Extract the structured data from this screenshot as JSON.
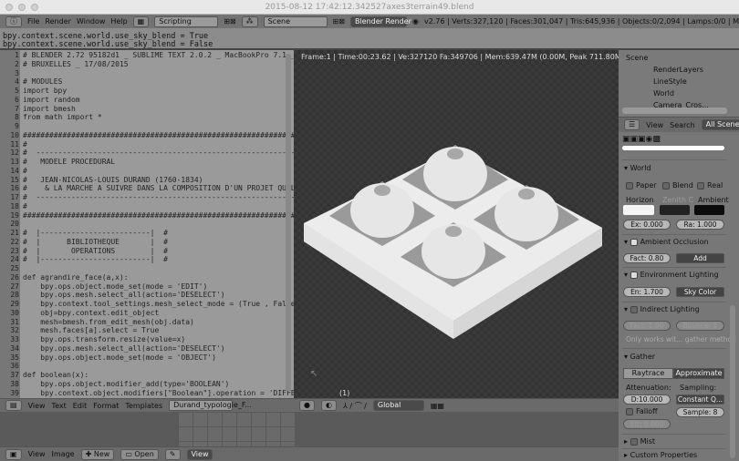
{
  "window": {
    "title": "2015-08-12 17:42:12.342527axes3terrain49.blend"
  },
  "topbar": {
    "menus": [
      "File",
      "Render",
      "Window",
      "Help"
    ],
    "layout": "Scripting",
    "scene": "Scene",
    "engine": "Blender Render",
    "stats": "v2.76 | Verts:327,120 | Faces:301,047 | Tris:645,936 | Objects:0/2,094 | Lamps:0/0 | M"
  },
  "console": {
    "lines": [
      "bpy.context.scene.world.use_sky_blend = True",
      "bpy.context.scene.world.use_sky_blend = False"
    ]
  },
  "editor": {
    "lines": [
      "# BLENDER 2.72 95182d1 _ SUBLIME TEXT 2.0.2 _ MacBookPro 7.1 _",
      "# BRUXELLES _ 17/08/2015",
      "",
      "# MODULES",
      "import bpy",
      "import random",
      "import bmesh",
      "from math import *",
      "",
      "##############################################################",
      "#",
      "#  ------------------------------------------------------------",
      "#   MODELE PROCEDURAL",
      "#",
      "#   JEAN-NICOLAS-LOUIS DURAND (1760-1834)",
      "#    & LA MARCHE A SUIVRE DANS LA COMPOSITION D'UN PROJET QUELC",
      "#  ------------------------------------------------------------",
      "#",
      "##############################################################",
      "",
      "#  |-------------------------|  #",
      "#  |      BIBLIOTHEQUE       |  #",
      "#  |       OPERATIONS        |  #",
      "#  |-------------------------|  #",
      "",
      "def agrandire_face(a,x):",
      "    bpy.ops.object.mode_set(mode = 'EDIT')",
      "    bpy.ops.mesh.select_all(action='DESELECT')",
      "    bpy.context.tool_settings.mesh_select_mode = (True , False",
      "    obj=bpy.context.edit_object",
      "    mesh=bmesh.from_edit_mesh(obj.data)",
      "    mesh.faces[a].select = True",
      "    bpy.ops.transform.resize(value=x)",
      "    bpy.ops.mesh.select_all(action='DESELECT')",
      "    bpy.ops.object.mode_set(mode = 'OBJECT')",
      "",
      "def boolean(x):",
      "    bpy.ops.object.modifier_add(type='BOOLEAN')",
      "    bpy.context.object.modifiers[\"Boolean\"].operation = 'DIFFER"
    ],
    "header": {
      "menus": [
        "View",
        "Text",
        "Edit",
        "Format",
        "Templates"
      ],
      "textblock": "Durand_typologie_F..."
    }
  },
  "viewport": {
    "info": "Frame:1 | Time:00:23.62 | Ve:327120 Fa:349706 | Mem:639.47M (0.00M, Peak 711.80M)",
    "frame_label": "(1)",
    "orientation": "Global"
  },
  "image_editor": {
    "menus": [
      "View",
      "Image"
    ],
    "new": "New",
    "open": "Open",
    "view": "View"
  },
  "outliner": {
    "items": [
      "Scene",
      "RenderLayers",
      "LineStyle",
      "World",
      "Camera_Cros..."
    ],
    "header": {
      "view": "View",
      "search": "Search",
      "filter": "All Scenes"
    }
  },
  "properties": {
    "world": {
      "title": "World",
      "paper": "Paper",
      "blend": "Blend",
      "real": "Real",
      "horizon": "Horizon",
      "zenith": "Zenith C",
      "ambient": "Ambient",
      "exposure": "Ex: 0.000",
      "range": "Ra: 1.000"
    },
    "ao": {
      "title": "Ambient Occlusion",
      "enabled": true,
      "factor": "Fact: 0.80",
      "mode": "Add"
    },
    "env": {
      "title": "Environment Lighting",
      "enabled": true,
      "energy": "En: 1.700",
      "source": "Sky Color"
    },
    "indirect": {
      "title": "Indirect Lighting",
      "enabled": false,
      "factor": "Fact: 1.00",
      "bounce": "Bounce: 1",
      "note": "Only works wit... gather method"
    },
    "gather": {
      "title": "Gather",
      "raytrace": "Raytrace",
      "approximate": "Approximate",
      "attenuation": "Attenuation:",
      "sampling": "Sampling:",
      "distance": "D:10.000",
      "sampling_mode": "Constant Q...",
      "falloff": "Falloff",
      "samples": "Sample: 8",
      "strength": "Str: 0.000"
    },
    "mist": {
      "title": "Mist"
    },
    "custom": {
      "title": "Custom Properties"
    }
  },
  "colors": {
    "horizon": "#f4f4f4",
    "zenith": "#222222",
    "ambient": "#0c0c0c"
  }
}
